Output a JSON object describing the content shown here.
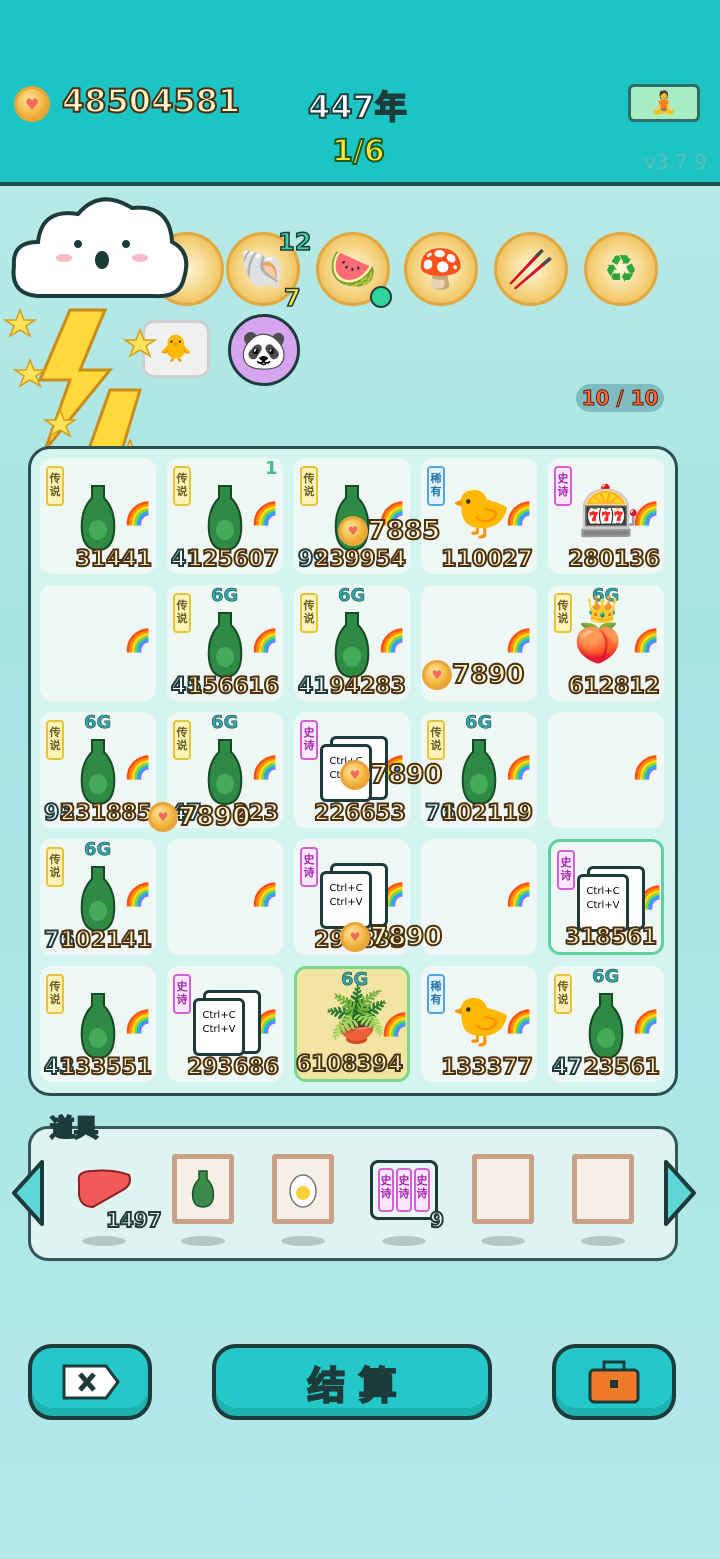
{
  "header": {
    "coins": "48504581",
    "year": "447年",
    "progress": "1/6",
    "version": "v3.7.9",
    "meditate_icon": "meditate-icon"
  },
  "medals": {
    "shell_top": "12",
    "shell_bottom": "7",
    "icons": [
      "cloud-icon",
      "shell-icon",
      "fruit-bowl-icon",
      "mushroom-cloud-icon",
      "ramen-icon",
      "recycle-icon"
    ]
  },
  "capacity": "10 / 10",
  "board": {
    "rows": [
      [
        {
          "tag": "传说",
          "tagType": "leg",
          "left": "",
          "right": "31441",
          "item": "vase",
          "extra": ""
        },
        {
          "tag": "传说",
          "tagType": "leg",
          "left": "41",
          "right": "125607",
          "item": "vase",
          "extra": "1"
        },
        {
          "tag": "传说",
          "tagType": "leg",
          "left": "99",
          "right": "239954",
          "item": "vase",
          "extra": ""
        },
        {
          "tag": "稀有",
          "tagType": "rare",
          "left": "",
          "right": "110027",
          "item": "chick",
          "extra": ""
        },
        {
          "tag": "史诗",
          "tagType": "epic",
          "left": "",
          "right": "280136",
          "item": "machine",
          "extra": ""
        }
      ],
      [
        {
          "tag": "",
          "tagType": "",
          "left": "",
          "right": "",
          "item": "",
          "extra": ""
        },
        {
          "tag": "传说",
          "tagType": "leg",
          "left": "45",
          "right": "156616",
          "item": "vase",
          "extra": "6G"
        },
        {
          "tag": "传说",
          "tagType": "leg",
          "left": "41",
          "right": "94283",
          "item": "vase",
          "extra": "6G"
        },
        {
          "tag": "",
          "tagType": "",
          "left": "",
          "right": "",
          "item": "",
          "extra": ""
        },
        {
          "tag": "传说",
          "tagType": "leg",
          "left": "",
          "right": "612812",
          "item": "crown",
          "extra": "6G"
        }
      ],
      [
        {
          "tag": "传说",
          "tagType": "leg",
          "left": "95",
          "right": "231885",
          "item": "vase",
          "extra": "6G"
        },
        {
          "tag": "传说",
          "tagType": "leg",
          "left": "47",
          "right": "223",
          "item": "vase",
          "extra": "6G"
        },
        {
          "tag": "史诗",
          "tagType": "epic",
          "left": "",
          "right": "226653",
          "item": "ctrl",
          "extra": ""
        },
        {
          "tag": "传说",
          "tagType": "leg",
          "left": "76",
          "right": "102119",
          "item": "vase",
          "extra": "6G"
        },
        {
          "tag": "",
          "tagType": "",
          "left": "",
          "right": "",
          "item": "",
          "extra": ""
        }
      ],
      [
        {
          "tag": "传说",
          "tagType": "leg",
          "left": "76",
          "right": "102141",
          "item": "vase",
          "extra": "6G"
        },
        {
          "tag": "",
          "tagType": "",
          "left": "",
          "right": "",
          "item": "",
          "extra": ""
        },
        {
          "tag": "史诗",
          "tagType": "epic",
          "left": "",
          "right": "299833",
          "item": "ctrl",
          "extra": ""
        },
        {
          "tag": "",
          "tagType": "",
          "left": "",
          "right": "",
          "item": "",
          "extra": ""
        },
        {
          "tag": "史诗",
          "tagType": "epic",
          "left": "",
          "right": "318561",
          "item": "ctrl",
          "extra": ""
        }
      ],
      [
        {
          "tag": "传说",
          "tagType": "leg",
          "left": "43",
          "right": "133551",
          "item": "vase",
          "extra": ""
        },
        {
          "tag": "史诗",
          "tagType": "epic",
          "left": "",
          "right": "293686",
          "item": "ctrl",
          "extra": ""
        },
        {
          "tag": "",
          "tagType": "",
          "left": "",
          "right": "6108394",
          "item": "plant",
          "extra": "6G"
        },
        {
          "tag": "稀有",
          "tagType": "rare",
          "left": "",
          "right": "133377",
          "item": "chick",
          "extra": ""
        },
        {
          "tag": "传说",
          "tagType": "leg",
          "left": "47",
          "right": "23561",
          "item": "vase",
          "extra": "6G"
        }
      ]
    ],
    "ctrl_c": "Ctrl+C",
    "ctrl_v": "Ctrl+V"
  },
  "floats": [
    "7885",
    "7890",
    "7890",
    "7890",
    "7890"
  ],
  "tools": {
    "label": "道具",
    "liver_count": "1497",
    "pack_count": "9",
    "pack_tags": [
      "史诗",
      "史诗",
      "史诗"
    ]
  },
  "actions": {
    "settle": "结 算"
  },
  "colors": {
    "teal": "#1cc4c4",
    "outline": "#1d3b3b"
  }
}
